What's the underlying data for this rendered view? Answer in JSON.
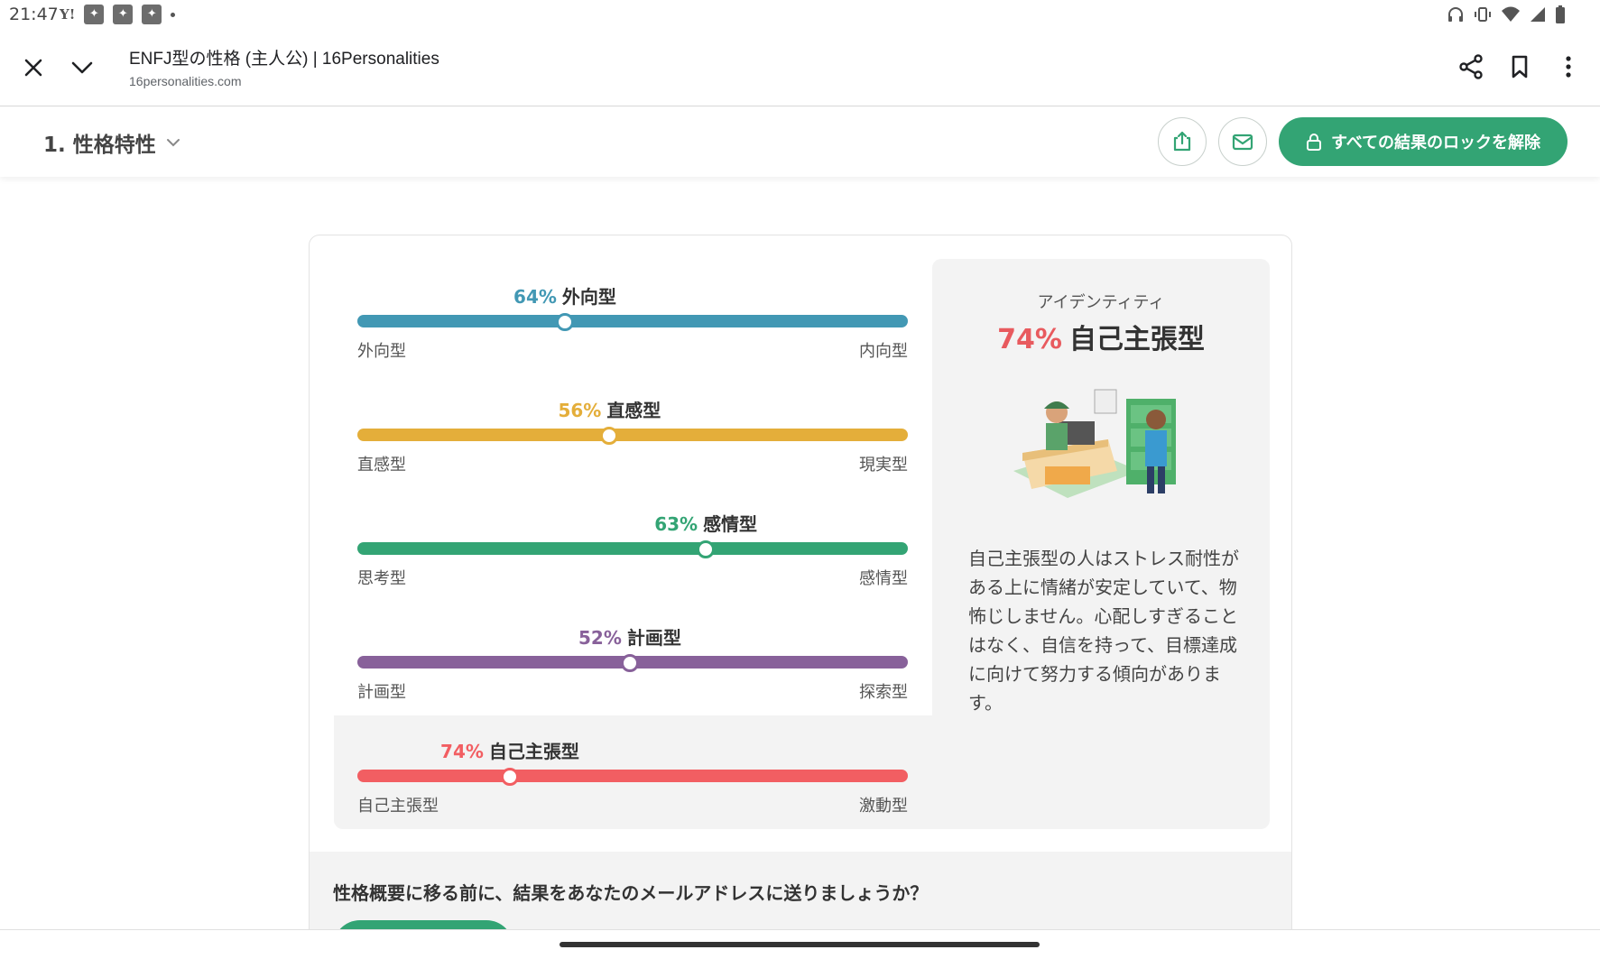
{
  "status_bar": {
    "time": "21:47",
    "left_icons": [
      "yahoo-icon",
      "app-icon",
      "app-icon",
      "app-icon",
      "dot"
    ],
    "right_icons": [
      "headphones-icon",
      "vibrate-icon",
      "wifi-icon",
      "signal-icon",
      "battery-icon"
    ],
    "yahoo_glyph": "Y!"
  },
  "browser": {
    "title": "ENFJ型の性格 (主人公) | 16Personalities",
    "url": "16personalities.com"
  },
  "nav": {
    "section_label": "1. 性格特性",
    "unlock_label": "すべての結果のロックを解除"
  },
  "traits": [
    {
      "percent_text": "64%",
      "name": "外向型",
      "left": "外向型",
      "right": "内向型",
      "position": 0.377,
      "color": "#4298b4"
    },
    {
      "percent_text": "56%",
      "name": "直感型",
      "left": "直感型",
      "right": "現実型",
      "position": 0.458,
      "color": "#e4ae3a"
    },
    {
      "percent_text": "63%",
      "name": "感情型",
      "left": "思考型",
      "right": "感情型",
      "position": 0.633,
      "color": "#33a474"
    },
    {
      "percent_text": "52%",
      "name": "計画型",
      "left": "計画型",
      "right": "探索型",
      "position": 0.495,
      "color": "#88619a"
    },
    {
      "percent_text": "74%",
      "name": "自己主張型",
      "left": "自己主張型",
      "right": "激動型",
      "position": 0.277,
      "color": "#f25e62"
    }
  ],
  "identity_panel": {
    "eyebrow": "アイデンティティ",
    "percent_text": "74%",
    "title": "自己主張型",
    "description": "自己主張型の人はストレス耐性がある上に情緒が安定していて、物怖じしません。心配しすぎることはなく、自信を持って、目標達成に向けて努力する傾向があります。",
    "accent": "#e85a5e"
  },
  "footer": {
    "question": "性格概要に移る前に、結果をあなたのメールアドレスに送りましょうか？"
  },
  "colors": {
    "brand_green": "#33a474"
  }
}
